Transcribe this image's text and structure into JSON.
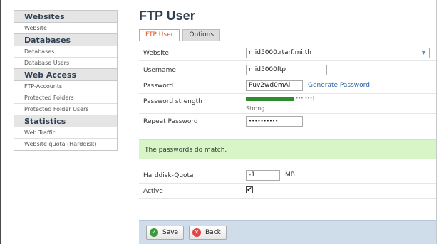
{
  "sidebar": {
    "groups": [
      {
        "title": "Websites",
        "items": [
          "Website"
        ]
      },
      {
        "title": "Databases",
        "items": [
          "Databases",
          "Database Users"
        ]
      },
      {
        "title": "Web Access",
        "items": [
          "FTP-Accounts",
          "Protected Folders",
          "Protected Folder Users"
        ]
      },
      {
        "title": "Statistics",
        "items": [
          "Web Traffic",
          "Website quota (Harddisk)"
        ]
      }
    ]
  },
  "page": {
    "title": "FTP User"
  },
  "tabs": [
    {
      "label": "FTP User",
      "active": true
    },
    {
      "label": "Options",
      "active": false
    }
  ],
  "form": {
    "website": {
      "label": "Website",
      "value": "mid5000.rtarf.mi.th"
    },
    "username": {
      "label": "Username",
      "value": "mid5000ftp"
    },
    "password": {
      "label": "Password",
      "value": "Puv2wd0mAi",
      "generate_label": "Generate Password"
    },
    "strength": {
      "label": "Password strength",
      "text": "Strong",
      "level": 0.85,
      "tick": "•••|•••|"
    },
    "repeat": {
      "label": "Repeat Password",
      "value": "••••••••••"
    },
    "message": "The passwords do match.",
    "quota": {
      "label": "Harddisk-Quota",
      "value": "-1",
      "unit": "MB"
    },
    "active": {
      "label": "Active",
      "checked": true
    }
  },
  "buttons": {
    "save": "Save",
    "back": "Back"
  },
  "colors": {
    "accent": "#e0541b",
    "strength": "#2e8b2e",
    "success_bg": "#d8f5c8",
    "footer_bg": "#cfdcea"
  },
  "icons": {
    "save": "check-circle-icon",
    "back": "x-circle-icon",
    "select": "chevron-down-icon"
  }
}
